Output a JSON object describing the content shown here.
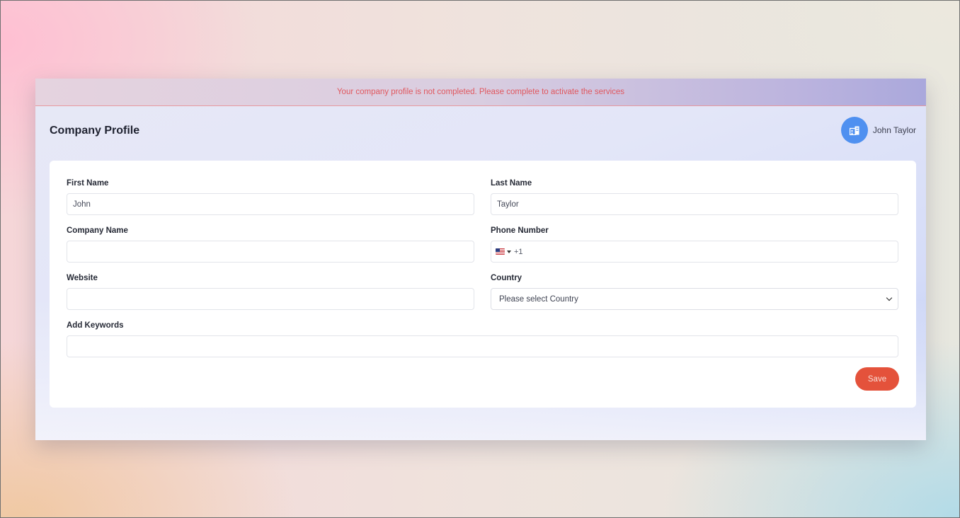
{
  "alert": {
    "message": "Your company profile is not completed. Please complete to activate the services"
  },
  "header": {
    "title": "Company Profile",
    "user_name": "John Taylor",
    "avatar_icon": "building-icon"
  },
  "form": {
    "first_name": {
      "label": "First Name",
      "value": "John",
      "placeholder": ""
    },
    "last_name": {
      "label": "Last Name",
      "value": "Taylor",
      "placeholder": ""
    },
    "company_name": {
      "label": "Company Name",
      "value": "",
      "placeholder": ""
    },
    "phone": {
      "label": "Phone Number",
      "country_flag": "us-flag-icon",
      "dial_code": "+1",
      "value": ""
    },
    "website": {
      "label": "Website",
      "value": "",
      "placeholder": ""
    },
    "country": {
      "label": "Country",
      "selected": "Please select Country"
    },
    "keywords": {
      "label": "Add Keywords",
      "value": "",
      "placeholder": ""
    },
    "save_label": "Save"
  },
  "colors": {
    "accent": "#e4523b",
    "alert_text": "#e0585f",
    "avatar": "#4f90f0"
  }
}
